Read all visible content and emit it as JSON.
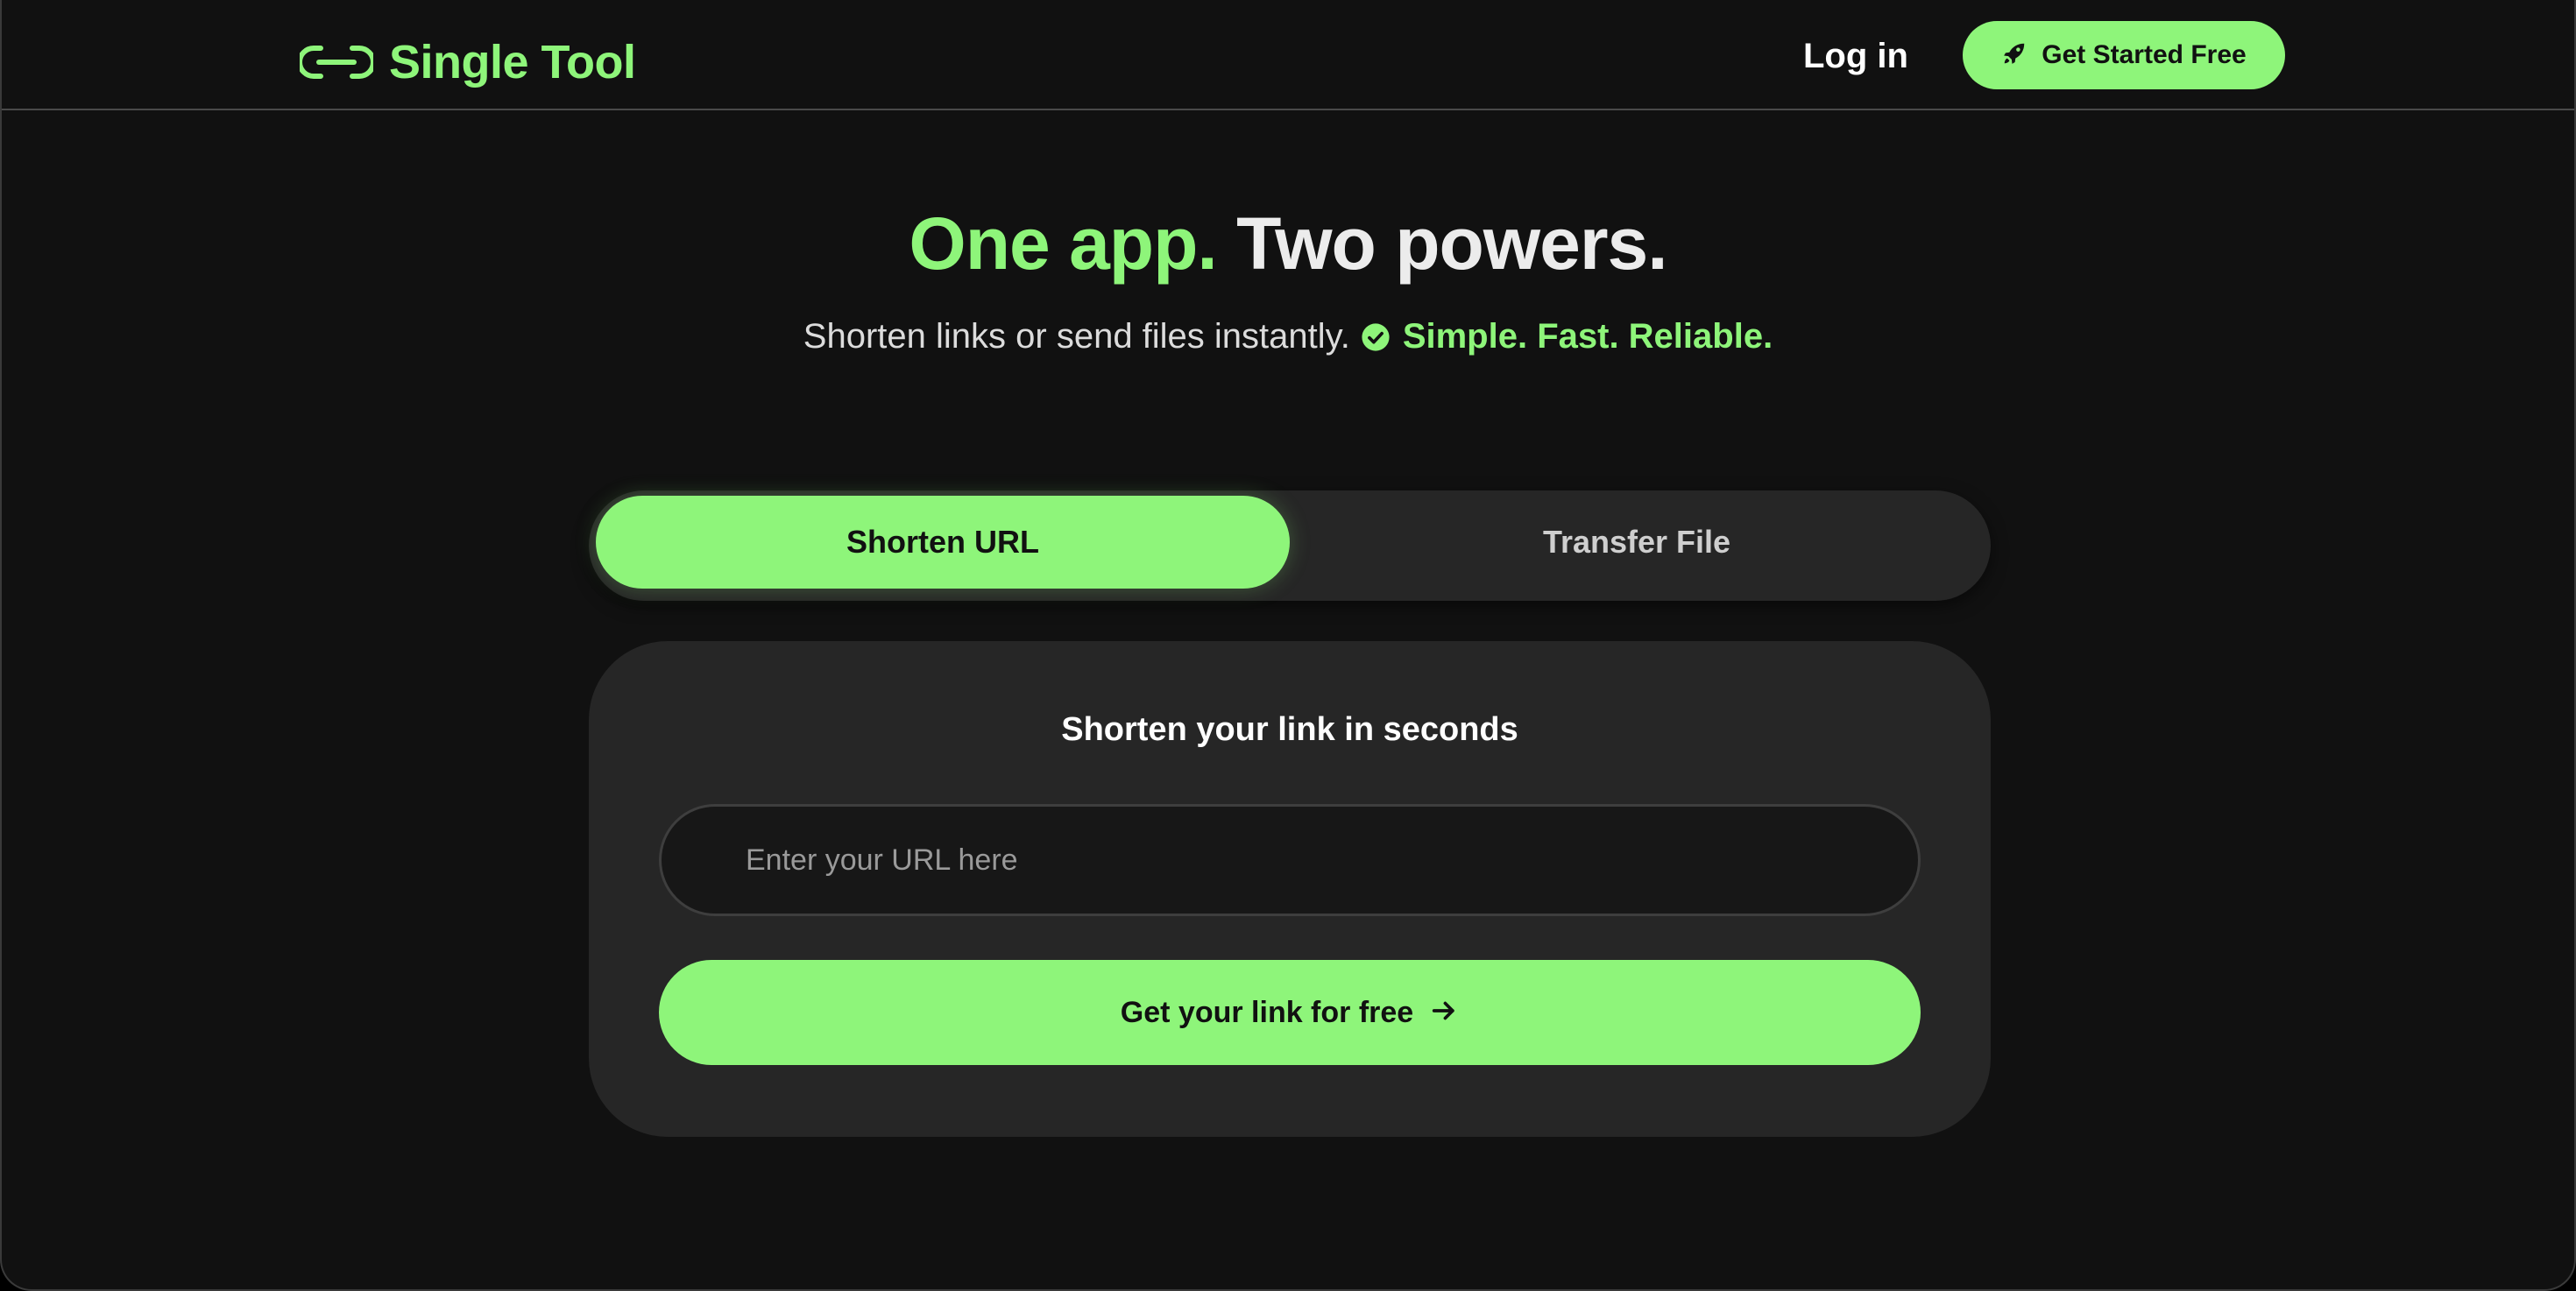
{
  "header": {
    "logo_text": "Single Tool",
    "login_label": "Log in",
    "cta_label": "Get Started Free"
  },
  "hero": {
    "title_part1": "One app.",
    "title_part2": "Two powers.",
    "subtitle": "Shorten links or send files instantly.",
    "highlight": "Simple. Fast. Reliable."
  },
  "tabs": [
    {
      "label": "Shorten URL",
      "active": true
    },
    {
      "label": "Transfer File",
      "active": false
    }
  ],
  "card": {
    "title": "Shorten your link in seconds",
    "input_placeholder": "Enter your URL here",
    "input_value": "",
    "button_label": "Get your link for free"
  },
  "icons": {
    "logo": "link-icon",
    "cta": "rocket-icon",
    "subtitle": "check-circle-icon",
    "button": "arrow-right-icon"
  },
  "colors": {
    "accent": "#8ef57a",
    "background": "#111111",
    "surface": "#262626",
    "input_background": "#171717"
  }
}
